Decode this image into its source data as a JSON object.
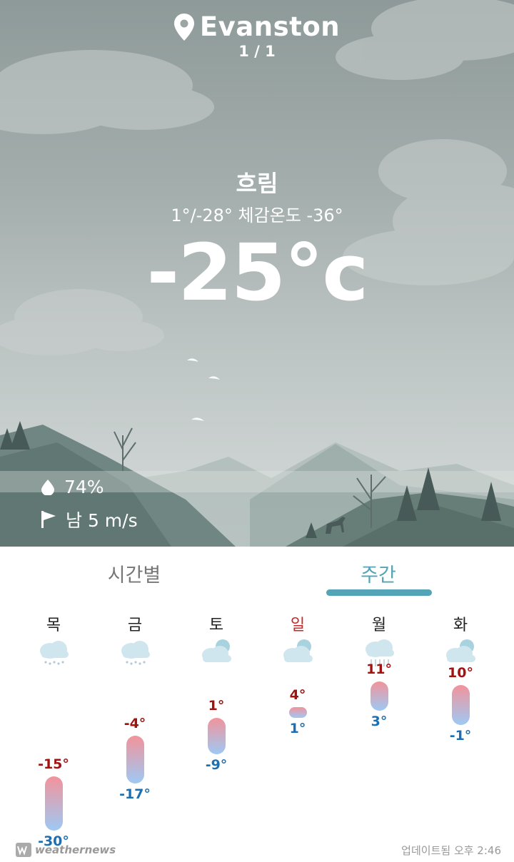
{
  "location": {
    "name": "Evanston",
    "page_indicator": "1 / 1"
  },
  "current": {
    "condition": "흐림",
    "range": "1°/-28° 체감온도 -36°",
    "temperature": "-25°c",
    "humidity": "74%",
    "wind": "남 5 m/s"
  },
  "tabs": {
    "hourly": "시간별",
    "weekly": "주간",
    "active": "weekly"
  },
  "days": [
    {
      "name": "목",
      "icon": "snow-cloud-icon",
      "hi": "-15°",
      "lo": "-30°",
      "hi_val": -15,
      "lo_val": -30
    },
    {
      "name": "금",
      "icon": "snow-cloud-icon",
      "hi": "-4°",
      "lo": "-17°",
      "hi_val": -4,
      "lo_val": -17
    },
    {
      "name": "토",
      "icon": "partly-cloudy-icon",
      "hi": "1°",
      "lo": "-9°",
      "hi_val": 1,
      "lo_val": -9
    },
    {
      "name": "일",
      "icon": "partly-cloudy-icon",
      "hi": "4°",
      "lo": "1°",
      "hi_val": 4,
      "lo_val": 1,
      "holiday": true
    },
    {
      "name": "월",
      "icon": "rain-cloud-icon",
      "hi": "11°",
      "lo": "3°",
      "hi_val": 11,
      "lo_val": 3
    },
    {
      "name": "화",
      "icon": "partly-cloudy-icon",
      "hi": "10°",
      "lo": "-1°",
      "hi_val": 10,
      "lo_val": -1
    }
  ],
  "footer": {
    "brand": "weathernews",
    "updated": "업데이트됨 오후 2:46"
  },
  "colors": {
    "accent": "#52a4b6",
    "high": "#a31111",
    "low": "#1d6fb3",
    "sunday": "#c62828"
  }
}
